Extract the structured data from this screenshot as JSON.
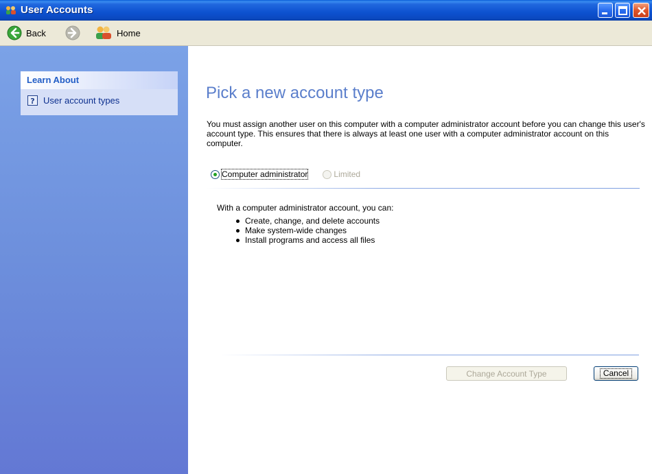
{
  "window": {
    "title": "User Accounts"
  },
  "toolbar": {
    "back_label": "Back",
    "home_label": "Home"
  },
  "sidebar": {
    "panel_title": "Learn About",
    "links": [
      {
        "label": "User account types"
      }
    ]
  },
  "main": {
    "page_title": "Pick a new account type",
    "intro": "You must assign another user on this computer with a computer administrator account before you can change this user's account type. This ensures that there is always at least one user with a computer administrator account on this computer.",
    "account_types": [
      {
        "label": "Computer administrator",
        "selected": true,
        "enabled": true
      },
      {
        "label": "Limited",
        "selected": false,
        "enabled": false
      }
    ],
    "description_heading": "With a computer administrator account, you can:",
    "capabilities": [
      "Create, change, and delete accounts",
      "Make system-wide changes",
      "Install programs and access all files"
    ],
    "buttons": {
      "change_label": "Change Account Type",
      "cancel_label": "Cancel"
    }
  },
  "colors": {
    "titlebar": "#0d52d0",
    "sidebar": "#6d8fdc",
    "page_title": "#5a7ecb",
    "link": "#0b2e8e"
  }
}
